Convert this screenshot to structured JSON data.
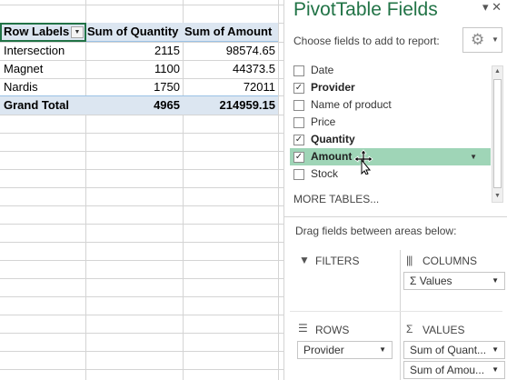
{
  "pivot_table": {
    "headers": [
      "Row Labels",
      "Sum of Quantity",
      "Sum of Amount"
    ],
    "rows": [
      {
        "label": "Intersection",
        "quantity": "2115",
        "amount": "98574.65"
      },
      {
        "label": "Magnet",
        "quantity": "1100",
        "amount": "44373.5"
      },
      {
        "label": "Nardis",
        "quantity": "1750",
        "amount": "72011"
      }
    ],
    "grand_total": {
      "label": "Grand Total",
      "quantity": "4965",
      "amount": "214959.15"
    }
  },
  "pane": {
    "title": "PivotTable Fields",
    "choose_label": "Choose fields to add to report:",
    "close_icon": "close-icon",
    "settings_icon": "gear-icon",
    "fields": [
      {
        "name": "Date",
        "checked": false,
        "highlight": false
      },
      {
        "name": "Provider",
        "checked": true,
        "highlight": false
      },
      {
        "name": "Name of product",
        "checked": false,
        "highlight": false
      },
      {
        "name": "Price",
        "checked": false,
        "highlight": false
      },
      {
        "name": "Quantity",
        "checked": true,
        "highlight": false
      },
      {
        "name": "Amount",
        "checked": true,
        "highlight": true
      },
      {
        "name": "Stock",
        "checked": false,
        "highlight": false
      }
    ],
    "more_tables": "MORE TABLES...",
    "drag_label": "Drag fields between areas below:",
    "areas": {
      "filters": {
        "label": "FILTERS",
        "icon": "filter-icon"
      },
      "columns": {
        "label": "COLUMNS",
        "icon": "columns-icon",
        "items": [
          "Σ Values"
        ]
      },
      "rows": {
        "label": "ROWS",
        "icon": "rows-icon",
        "items": [
          "Provider"
        ]
      },
      "values": {
        "label": "VALUES",
        "icon": "sigma-icon",
        "items": [
          "Sum of Quant...",
          "Sum of Amou..."
        ]
      }
    }
  },
  "colors": {
    "accent": "#217346",
    "header_fill": "#dce6f1",
    "highlight": "#9fd5b7"
  }
}
